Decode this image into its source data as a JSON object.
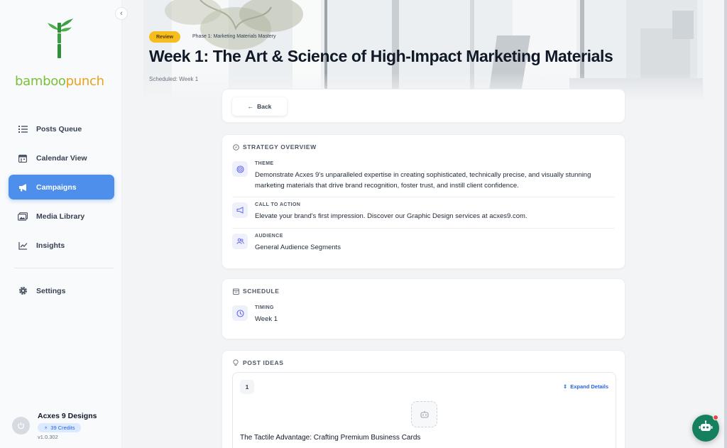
{
  "sidebar": {
    "brand": {
      "part1": "bamboo",
      "part2": "punch"
    },
    "items": [
      {
        "label": "Posts Queue",
        "icon": "list-icon"
      },
      {
        "label": "Calendar View",
        "icon": "calendar-icon"
      },
      {
        "label": "Campaigns",
        "icon": "megaphone-icon",
        "active": true
      },
      {
        "label": "Media Library",
        "icon": "image-icon"
      },
      {
        "label": "Insights",
        "icon": "chart-line-icon"
      }
    ],
    "settings": {
      "label": "Settings",
      "icon": "gear-icon"
    },
    "profile": {
      "name": "Acxes 9 Designs",
      "credits": "39 Credits",
      "version": "v1.0.302"
    }
  },
  "hero": {
    "status": "Review",
    "phase": "Phase 1: Marketing Materials Mastery",
    "title": "Week 1: The Art & Science of High-Impact Marketing Materials",
    "scheduled": "Scheduled: Week 1"
  },
  "back_label": "Back",
  "strategy": {
    "heading": "STRATEGY OVERVIEW",
    "theme": {
      "label": "THEME",
      "text": "Demonstrate Acxes 9's unparalleled expertise in creating sophisticated, technically precise, and visually stunning marketing materials that drive brand recognition, foster trust, and instill client confidence."
    },
    "cta": {
      "label": "CALL TO ACTION",
      "text": "Elevate your brand's first impression. Discover our Graphic Design services at acxes9.com."
    },
    "audience": {
      "label": "AUDIENCE",
      "text": "General Audience Segments"
    }
  },
  "schedule": {
    "heading": "SCHEDULE",
    "timing": {
      "label": "TIMING",
      "text": "Week 1"
    }
  },
  "post_ideas": {
    "heading": "POST IDEAS",
    "expand_label": "Expand Details",
    "items": [
      {
        "number": "1",
        "title": "The Tactile Advantage: Crafting Premium Business Cards"
      }
    ]
  },
  "colors": {
    "accent": "#4d8fea",
    "review_badge": "#f6bd1f",
    "chat_button": "#14805e",
    "brand_green": "#7cbf3a",
    "brand_orange": "#e8a21c"
  }
}
